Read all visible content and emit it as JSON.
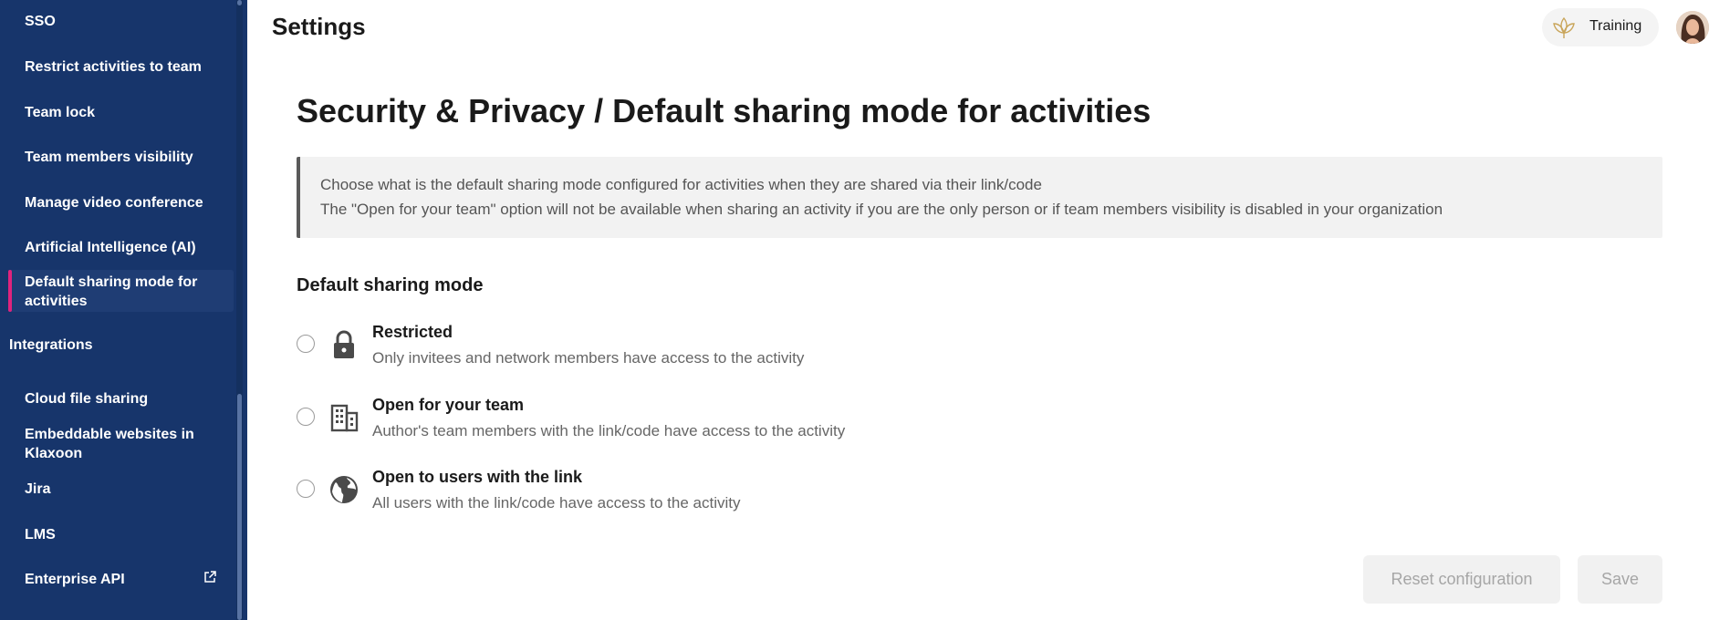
{
  "sidebar": {
    "items": [
      {
        "label": "SSO"
      },
      {
        "label": "Restrict activities to team"
      },
      {
        "label": "Team lock"
      },
      {
        "label": "Team members visibility"
      },
      {
        "label": "Manage video conference"
      },
      {
        "label": "Artificial Intelligence (AI)"
      },
      {
        "label_line1": "Default sharing mode for",
        "label_line2": "activities"
      }
    ],
    "section_integrations": "Integrations",
    "integrations": [
      {
        "label": "Cloud file sharing"
      },
      {
        "label_line1": "Embeddable websites in",
        "label_line2": "Klaxoon"
      },
      {
        "label": "Jira"
      },
      {
        "label": "LMS"
      },
      {
        "label": "Enterprise API"
      }
    ]
  },
  "header": {
    "title": "Settings",
    "workspace_label": "Training",
    "workspace_icon": "lotus-logo-icon",
    "avatar": "user-avatar"
  },
  "main": {
    "title": "Security & Privacy / Default sharing mode for activities",
    "info_line1": "Choose what is the default sharing mode configured for activities when they are shared via their link/code",
    "info_line2": "The \"Open for your team\" option will not be available when sharing an activity if you are the only person or if team members visibility is disabled in your organization",
    "section_title": "Default sharing mode",
    "options": [
      {
        "label": "Restricted",
        "description": "Only invitees and network members have access to the activity",
        "icon": "lock-icon"
      },
      {
        "label": "Open for your team",
        "description": "Author's team members with the link/code have access to the activity",
        "icon": "building-icon"
      },
      {
        "label": "Open to users with the link",
        "description": "All users with the link/code have access to the activity",
        "icon": "globe-icon"
      }
    ],
    "reset_label": "Reset configuration",
    "save_label": "Save"
  },
  "colors": {
    "sidebar_bg": "#17356b",
    "active_indicator": "#e0237d",
    "button_bg": "#f1f1f1",
    "button_text": "#a6a6a6"
  }
}
